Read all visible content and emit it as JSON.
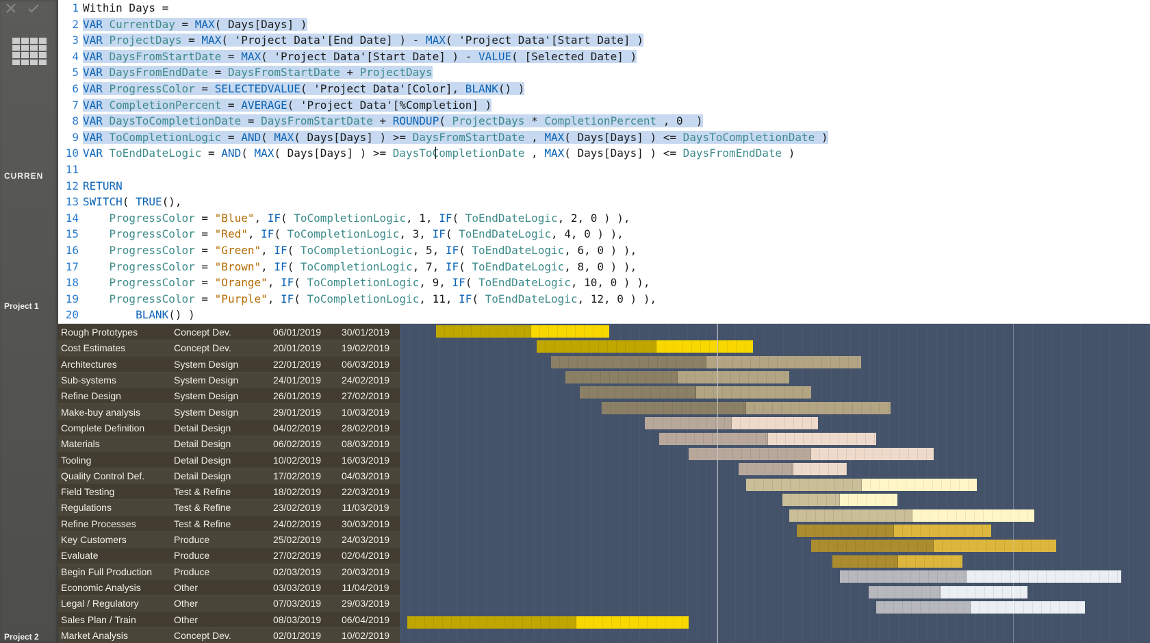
{
  "toolbar": {
    "label_curren": "CURREN",
    "label_proj1": "Project 1",
    "label_proj2": "Project 2"
  },
  "formula": {
    "lines": [
      {
        "n": 1,
        "raw": "Within Days =",
        "hl": false,
        "tokens": [
          [
            "txt",
            "Within Days ="
          ]
        ]
      },
      {
        "n": 2,
        "raw": "VAR CurrentDay = MAX( Days[Days] )",
        "hl": true,
        "tokens": [
          [
            "kw",
            "VAR "
          ],
          [
            "var",
            "CurrentDay"
          ],
          [
            "txt",
            " = "
          ],
          [
            "fn",
            "MAX"
          ],
          [
            "txt",
            "( Days[Days] )"
          ]
        ]
      },
      {
        "n": 3,
        "raw": "VAR ProjectDays = MAX( 'Project Data'[End Date] ) - MAX( 'Project Data'[Start Date] )",
        "hl": true,
        "tokens": [
          [
            "kw",
            "VAR "
          ],
          [
            "var",
            "ProjectDays"
          ],
          [
            "txt",
            " = "
          ],
          [
            "fn",
            "MAX"
          ],
          [
            "txt",
            "( 'Project Data'[End Date] ) - "
          ],
          [
            "fn",
            "MAX"
          ],
          [
            "txt",
            "( 'Project Data'[Start Date] )"
          ]
        ]
      },
      {
        "n": 4,
        "raw": "VAR DaysFromStartDate = MAX( 'Project Data'[Start Date] ) - VALUE( [Selected Date] )",
        "hl": true,
        "tokens": [
          [
            "kw",
            "VAR "
          ],
          [
            "var",
            "DaysFromStartDate"
          ],
          [
            "txt",
            " = "
          ],
          [
            "fn",
            "MAX"
          ],
          [
            "txt",
            "( 'Project Data'[Start Date] ) - "
          ],
          [
            "fn",
            "VALUE"
          ],
          [
            "txt",
            "( [Selected Date] )"
          ]
        ]
      },
      {
        "n": 5,
        "raw": "VAR DaysFromEndDate = DaysFromStartDate + ProjectDays",
        "hl": true,
        "tokens": [
          [
            "kw",
            "VAR "
          ],
          [
            "var",
            "DaysFromEndDate"
          ],
          [
            "txt",
            " = "
          ],
          [
            "var",
            "DaysFromStartDate"
          ],
          [
            "txt",
            " + "
          ],
          [
            "var",
            "ProjectDays"
          ]
        ]
      },
      {
        "n": 6,
        "raw": "VAR ProgressColor = SELECTEDVALUE( 'Project Data'[Color], BLANK() )",
        "hl": true,
        "tokens": [
          [
            "kw",
            "VAR "
          ],
          [
            "var",
            "ProgressColor"
          ],
          [
            "txt",
            " = "
          ],
          [
            "fn",
            "SELECTEDVALUE"
          ],
          [
            "txt",
            "( 'Project Data'[Color], "
          ],
          [
            "fn",
            "BLANK"
          ],
          [
            "txt",
            "() )"
          ]
        ]
      },
      {
        "n": 7,
        "raw": "VAR CompletionPercent = AVERAGE( 'Project Data'[%Completion] )",
        "hl": true,
        "tokens": [
          [
            "kw",
            "VAR "
          ],
          [
            "var",
            "CompletionPercent"
          ],
          [
            "txt",
            " = "
          ],
          [
            "fn",
            "AVERAGE"
          ],
          [
            "txt",
            "( 'Project Data'[%Completion] )"
          ]
        ]
      },
      {
        "n": 8,
        "raw": "VAR DaysToCompletionDate = DaysFromStartDate + ROUNDUP( ProjectDays * CompletionPercent , 0  )",
        "hl": true,
        "tokens": [
          [
            "kw",
            "VAR "
          ],
          [
            "var",
            "DaysToCompletionDate"
          ],
          [
            "txt",
            " = "
          ],
          [
            "var",
            "DaysFromStartDate"
          ],
          [
            "txt",
            " + "
          ],
          [
            "fn",
            "ROUNDUP"
          ],
          [
            "txt",
            "( "
          ],
          [
            "var",
            "ProjectDays"
          ],
          [
            "txt",
            " * "
          ],
          [
            "var",
            "CompletionPercent"
          ],
          [
            "txt",
            " , 0  )"
          ]
        ]
      },
      {
        "n": 9,
        "raw": "VAR ToCompletionLogic = AND( MAX( Days[Days] ) >= DaysFromStartDate , MAX( Days[Days] ) <= DaysToCompletionDate )",
        "hl": true,
        "tokens": [
          [
            "kw",
            "VAR "
          ],
          [
            "var",
            "ToCompletionLogic"
          ],
          [
            "txt",
            " = "
          ],
          [
            "fn",
            "AND"
          ],
          [
            "txt",
            "( "
          ],
          [
            "fn",
            "MAX"
          ],
          [
            "txt",
            "( Days[Days] ) >= "
          ],
          [
            "var",
            "DaysFromStartDate"
          ],
          [
            "txt",
            " , "
          ],
          [
            "fn",
            "MAX"
          ],
          [
            "txt",
            "( Days[Days] ) <= "
          ],
          [
            "var",
            "DaysToCompletionDate"
          ],
          [
            "txt",
            " )"
          ]
        ]
      },
      {
        "n": 10,
        "raw": "VAR ToEndDateLogic = AND( MAX( Days[Days] ) >= DaysToCompletionDate , MAX( Days[Days] ) <= DaysFromEndDate )",
        "hl": false,
        "caret_after": "DaysToCompl",
        "tokens": [
          [
            "kw",
            "VAR "
          ],
          [
            "var",
            "ToEndDateLogic"
          ],
          [
            "txt",
            " = "
          ],
          [
            "fn",
            "AND"
          ],
          [
            "txt",
            "( "
          ],
          [
            "fn",
            "MAX"
          ],
          [
            "txt",
            "( Days[Days] ) >= "
          ],
          [
            "var",
            "DaysToCompletionDate"
          ],
          [
            "txt",
            " , "
          ],
          [
            "fn",
            "MAX"
          ],
          [
            "txt",
            "( Days[Days] ) <= "
          ],
          [
            "var",
            "DaysFromEndDate"
          ],
          [
            "txt",
            " )"
          ]
        ]
      },
      {
        "n": 11,
        "raw": "",
        "hl": false,
        "tokens": []
      },
      {
        "n": 12,
        "raw": "RETURN",
        "hl": false,
        "tokens": [
          [
            "kw",
            "RETURN"
          ]
        ]
      },
      {
        "n": 13,
        "raw": "SWITCH( TRUE(),",
        "hl": false,
        "tokens": [
          [
            "fn",
            "SWITCH"
          ],
          [
            "txt",
            "( "
          ],
          [
            "fn",
            "TRUE"
          ],
          [
            "txt",
            "(),"
          ]
        ]
      },
      {
        "n": 14,
        "raw": "    ProgressColor = \"Blue\", IF( ToCompletionLogic, 1, IF( ToEndDateLogic, 2, 0 ) ),",
        "hl": false,
        "tokens": [
          [
            "txt",
            "    "
          ],
          [
            "var",
            "ProgressColor"
          ],
          [
            "txt",
            " = "
          ],
          [
            "str",
            "\"Blue\""
          ],
          [
            "txt",
            ", "
          ],
          [
            "fn",
            "IF"
          ],
          [
            "txt",
            "( "
          ],
          [
            "var",
            "ToCompletionLogic"
          ],
          [
            "txt",
            ", 1, "
          ],
          [
            "fn",
            "IF"
          ],
          [
            "txt",
            "( "
          ],
          [
            "var",
            "ToEndDateLogic"
          ],
          [
            "txt",
            ", 2, 0 ) ),"
          ]
        ]
      },
      {
        "n": 15,
        "raw": "    ProgressColor = \"Red\", IF( ToCompletionLogic, 3, IF( ToEndDateLogic, 4, 0 ) ),",
        "hl": false,
        "tokens": [
          [
            "txt",
            "    "
          ],
          [
            "var",
            "ProgressColor"
          ],
          [
            "txt",
            " = "
          ],
          [
            "str",
            "\"Red\""
          ],
          [
            "txt",
            ", "
          ],
          [
            "fn",
            "IF"
          ],
          [
            "txt",
            "( "
          ],
          [
            "var",
            "ToCompletionLogic"
          ],
          [
            "txt",
            ", 3, "
          ],
          [
            "fn",
            "IF"
          ],
          [
            "txt",
            "( "
          ],
          [
            "var",
            "ToEndDateLogic"
          ],
          [
            "txt",
            ", 4, 0 ) ),"
          ]
        ]
      },
      {
        "n": 16,
        "raw": "    ProgressColor = \"Green\", IF( ToCompletionLogic, 5, IF( ToEndDateLogic, 6, 0 ) ),",
        "hl": false,
        "tokens": [
          [
            "txt",
            "    "
          ],
          [
            "var",
            "ProgressColor"
          ],
          [
            "txt",
            " = "
          ],
          [
            "str",
            "\"Green\""
          ],
          [
            "txt",
            ", "
          ],
          [
            "fn",
            "IF"
          ],
          [
            "txt",
            "( "
          ],
          [
            "var",
            "ToCompletionLogic"
          ],
          [
            "txt",
            ", 5, "
          ],
          [
            "fn",
            "IF"
          ],
          [
            "txt",
            "( "
          ],
          [
            "var",
            "ToEndDateLogic"
          ],
          [
            "txt",
            ", 6, 0 ) ),"
          ]
        ]
      },
      {
        "n": 17,
        "raw": "    ProgressColor = \"Brown\", IF( ToCompletionLogic, 7, IF( ToEndDateLogic, 8, 0 ) ),",
        "hl": false,
        "tokens": [
          [
            "txt",
            "    "
          ],
          [
            "var",
            "ProgressColor"
          ],
          [
            "txt",
            " = "
          ],
          [
            "str",
            "\"Brown\""
          ],
          [
            "txt",
            ", "
          ],
          [
            "fn",
            "IF"
          ],
          [
            "txt",
            "( "
          ],
          [
            "var",
            "ToCompletionLogic"
          ],
          [
            "txt",
            ", 7, "
          ],
          [
            "fn",
            "IF"
          ],
          [
            "txt",
            "( "
          ],
          [
            "var",
            "ToEndDateLogic"
          ],
          [
            "txt",
            ", 8, 0 ) ),"
          ]
        ]
      },
      {
        "n": 18,
        "raw": "    ProgressColor = \"Orange\", IF( ToCompletionLogic, 9, IF( ToEndDateLogic, 10, 0 ) ),",
        "hl": false,
        "tokens": [
          [
            "txt",
            "    "
          ],
          [
            "var",
            "ProgressColor"
          ],
          [
            "txt",
            " = "
          ],
          [
            "str",
            "\"Orange\""
          ],
          [
            "txt",
            ", "
          ],
          [
            "fn",
            "IF"
          ],
          [
            "txt",
            "( "
          ],
          [
            "var",
            "ToCompletionLogic"
          ],
          [
            "txt",
            ", 9, "
          ],
          [
            "fn",
            "IF"
          ],
          [
            "txt",
            "( "
          ],
          [
            "var",
            "ToEndDateLogic"
          ],
          [
            "txt",
            ", 10, 0 ) ),"
          ]
        ]
      },
      {
        "n": 19,
        "raw": "    ProgressColor = \"Purple\", IF( ToCompletionLogic, 11, IF( ToEndDateLogic, 12, 0 ) ),",
        "hl": false,
        "tokens": [
          [
            "txt",
            "    "
          ],
          [
            "var",
            "ProgressColor"
          ],
          [
            "txt",
            " = "
          ],
          [
            "str",
            "\"Purple\""
          ],
          [
            "txt",
            ", "
          ],
          [
            "fn",
            "IF"
          ],
          [
            "txt",
            "( "
          ],
          [
            "var",
            "ToCompletionLogic"
          ],
          [
            "txt",
            ", 11, "
          ],
          [
            "fn",
            "IF"
          ],
          [
            "txt",
            "( "
          ],
          [
            "var",
            "ToEndDateLogic"
          ],
          [
            "txt",
            ", 12, 0 ) ),"
          ]
        ]
      },
      {
        "n": 20,
        "raw": "        BLANK() )",
        "hl": false,
        "tokens": [
          [
            "txt",
            "        "
          ],
          [
            "fn",
            "BLANK"
          ],
          [
            "txt",
            "() )"
          ]
        ]
      }
    ]
  },
  "chart_data": {
    "type": "gantt",
    "date_range": [
      "01/01/2019",
      "15/04/2019"
    ],
    "today_line": "14/02/2019",
    "rows": [
      {
        "task": "Rough Prototypes",
        "phase": "Concept Dev.",
        "start": "06/01/2019",
        "end": "30/01/2019",
        "color": "#e2c400",
        "progress": 0.55
      },
      {
        "task": "Cost Estimates",
        "phase": "Concept Dev.",
        "start": "20/01/2019",
        "end": "19/02/2019",
        "color": "#e2c400",
        "progress": 0.55
      },
      {
        "task": "Architectures",
        "phase": "System Design",
        "start": "22/01/2019",
        "end": "06/03/2019",
        "color": "#a39678",
        "progress": 0.5
      },
      {
        "task": "Sub-systems",
        "phase": "System Design",
        "start": "24/01/2019",
        "end": "24/02/2019",
        "color": "#a39678",
        "progress": 0.5
      },
      {
        "task": "Refine Design",
        "phase": "System Design",
        "start": "26/01/2019",
        "end": "27/02/2019",
        "color": "#a39678",
        "progress": 0.5
      },
      {
        "task": "Make-buy analysis",
        "phase": "System Design",
        "start": "29/01/2019",
        "end": "10/03/2019",
        "color": "#a39678",
        "progress": 0.5
      },
      {
        "task": "Complete Definition",
        "phase": "Detail Design",
        "start": "04/02/2019",
        "end": "28/02/2019",
        "color": "#d8c6b8",
        "progress": 0.5
      },
      {
        "task": "Materials",
        "phase": "Detail Design",
        "start": "06/02/2019",
        "end": "08/03/2019",
        "color": "#d8c6b8",
        "progress": 0.5
      },
      {
        "task": "Tooling",
        "phase": "Detail Design",
        "start": "10/02/2019",
        "end": "16/03/2019",
        "color": "#d8c6b8",
        "progress": 0.5
      },
      {
        "task": "Quality Control Def.",
        "phase": "Detail Design",
        "start": "17/02/2019",
        "end": "04/03/2019",
        "color": "#d8c6b8",
        "progress": 0.5
      },
      {
        "task": "Field Testing",
        "phase": "Test & Refine",
        "start": "18/02/2019",
        "end": "22/03/2019",
        "color": "#eee0b4",
        "progress": 0.5
      },
      {
        "task": "Regulations",
        "phase": "Test & Refine",
        "start": "23/02/2019",
        "end": "11/03/2019",
        "color": "#eee0b4",
        "progress": 0.5
      },
      {
        "task": "Refine Processes",
        "phase": "Test & Refine",
        "start": "24/02/2019",
        "end": "30/03/2019",
        "color": "#eee0b4",
        "progress": 0.5
      },
      {
        "task": "Key Customers",
        "phase": "Produce",
        "start": "25/02/2019",
        "end": "24/03/2019",
        "color": "#c9a637",
        "progress": 0.5
      },
      {
        "task": "Evaluate",
        "phase": "Produce",
        "start": "27/02/2019",
        "end": "02/04/2019",
        "color": "#c9a637",
        "progress": 0.5
      },
      {
        "task": "Begin Full Production",
        "phase": "Produce",
        "start": "02/03/2019",
        "end": "20/03/2019",
        "color": "#c9a637",
        "progress": 0.5
      },
      {
        "task": "Economic Analysis",
        "phase": "Other",
        "start": "03/03/2019",
        "end": "11/04/2019",
        "color": "#d6d9de",
        "progress": 0.45
      },
      {
        "task": "Legal / Regulatory",
        "phase": "Other",
        "start": "07/03/2019",
        "end": "29/03/2019",
        "color": "#d6d9de",
        "progress": 0.45
      },
      {
        "task": "Sales Plan / Train",
        "phase": "Other",
        "start": "08/03/2019",
        "end": "06/04/2019",
        "color": "#d6d9de",
        "progress": 0.45
      },
      {
        "task": "Market Analysis",
        "phase": "Concept Dev.",
        "start": "02/01/2019",
        "end": "10/02/2019",
        "color": "#e2c400",
        "progress": 0.6
      }
    ],
    "vertical_lines": [
      {
        "date": "14/02/2019",
        "color": "#c2c2c2"
      },
      {
        "date": "27/03/2019",
        "color": "rgba(255,255,255,0.25)"
      }
    ]
  }
}
